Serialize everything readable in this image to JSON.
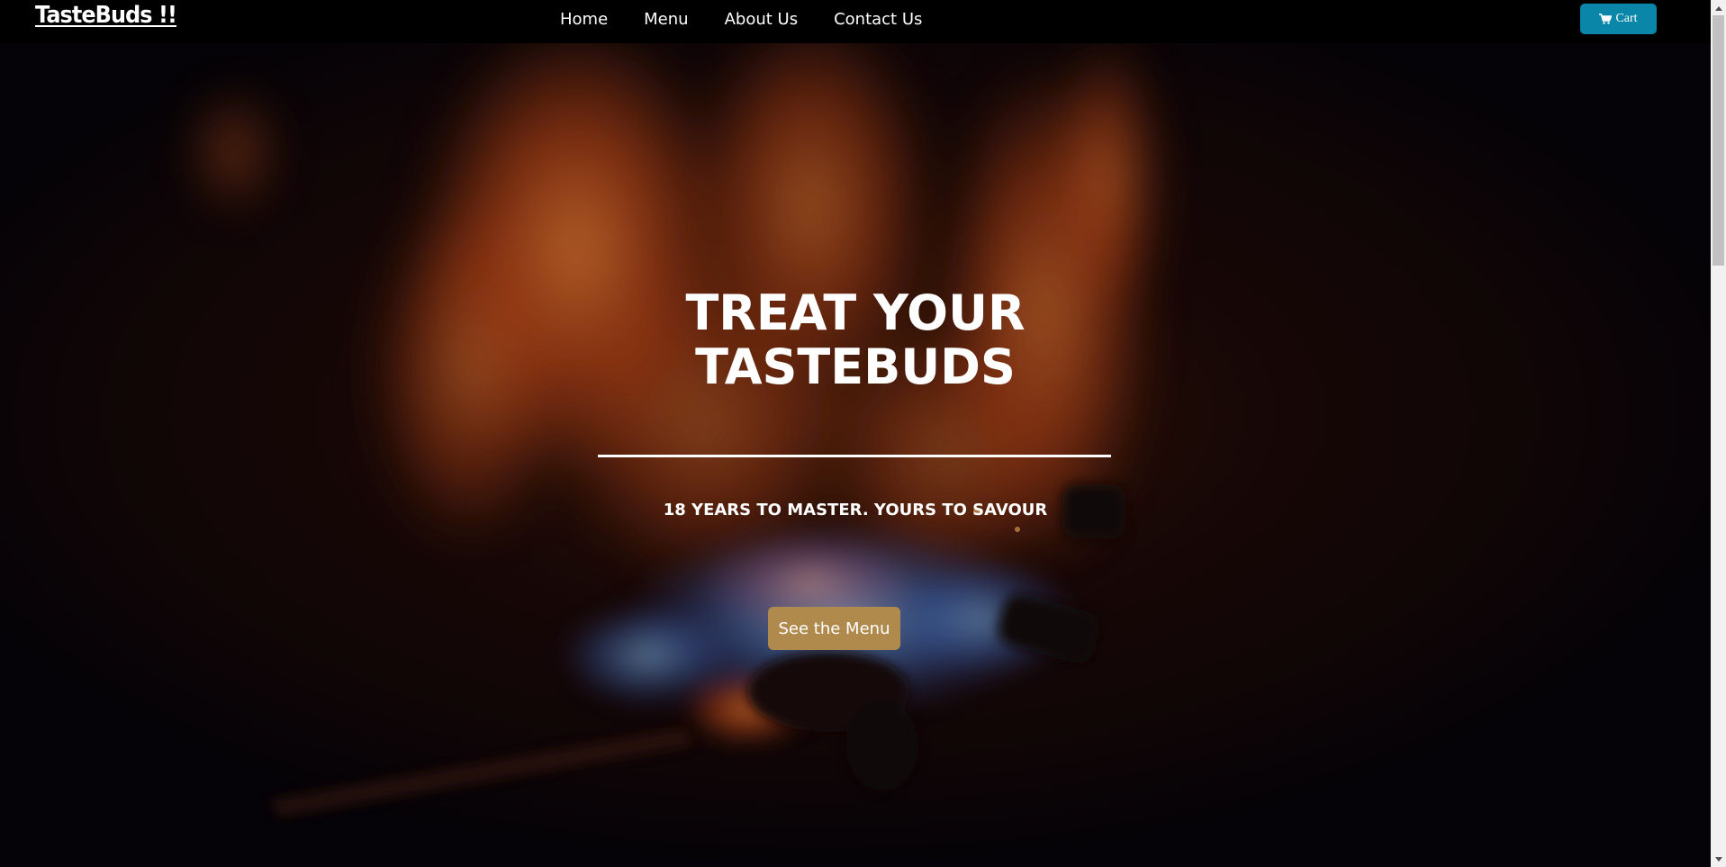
{
  "navbar": {
    "brand": "TasteBuds !!",
    "links": [
      "Home",
      "Menu",
      "About Us",
      "Contact Us"
    ],
    "cart_label": "Cart"
  },
  "hero": {
    "title_line1": "TREAT YOUR",
    "title_line2": "TASTEBUDS",
    "subtitle": "18 YEARS TO MASTER. YOURS TO SAVOUR",
    "cta_label": "See the Menu"
  },
  "colors": {
    "navbar_bg": "#000000",
    "cart_button": "#0a86a8",
    "cta_button": "#b08a4d",
    "text": "#ffffff"
  },
  "icons": {
    "cart": "shopping-cart-icon"
  }
}
